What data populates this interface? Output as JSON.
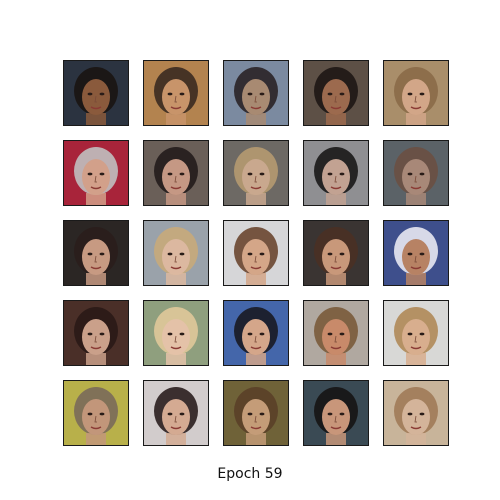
{
  "figure": {
    "caption": "Epoch 59",
    "grid_rows": 5,
    "grid_cols": 5,
    "samples": [
      {
        "bg": "#2b3340",
        "skin": "#8a5a3c",
        "hair": "#1a1412"
      },
      {
        "bg": "#b3834f",
        "skin": "#c8946a",
        "hair": "#3a2a20"
      },
      {
        "bg": "#7b8aa0",
        "skin": "#a88a72",
        "hair": "#2a2226"
      },
      {
        "bg": "#5d5046",
        "skin": "#9c6a4e",
        "hair": "#1e1614"
      },
      {
        "bg": "#a98e6a",
        "skin": "#d2a688",
        "hair": "#8a6a48"
      },
      {
        "bg": "#a8243a",
        "skin": "#d2a08a",
        "hair": "#c0c0c0"
      },
      {
        "bg": "#6a5f58",
        "skin": "#c59884",
        "hair": "#241c1c"
      },
      {
        "bg": "#6d6964",
        "skin": "#c9a88e",
        "hair": "#b59a70"
      },
      {
        "bg": "#8f8f92",
        "skin": "#c2a292",
        "hair": "#1a1818"
      },
      {
        "bg": "#5b6267",
        "skin": "#a88878",
        "hair": "#6a5042"
      },
      {
        "bg": "#2b2624",
        "skin": "#c79a82",
        "hair": "#2a1e1c"
      },
      {
        "bg": "#9aa2aa",
        "skin": "#dcb8a0",
        "hair": "#c8aa7a"
      },
      {
        "bg": "#d6d6d8",
        "skin": "#d4a688",
        "hair": "#6a4630"
      },
      {
        "bg": "#3a3432",
        "skin": "#c8987a",
        "hair": "#4a3024"
      },
      {
        "bg": "#3e4f8c",
        "skin": "#b78264",
        "hair": "#e8e8f2"
      },
      {
        "bg": "#4a2f28",
        "skin": "#caa08a",
        "hair": "#2a1a16"
      },
      {
        "bg": "#8f9f7e",
        "skin": "#e4c2a8",
        "hair": "#e0c89a"
      },
      {
        "bg": "#4466aa",
        "skin": "#d4a68a",
        "hair": "#1a1a22"
      },
      {
        "bg": "#b0a8a0",
        "skin": "#c88a6a",
        "hair": "#7a5a3a"
      },
      {
        "bg": "#d8d8d6",
        "skin": "#d8ae8e",
        "hair": "#b08a58"
      },
      {
        "bg": "#b8b04a",
        "skin": "#c2967a",
        "hair": "#7a6a5a"
      },
      {
        "bg": "#d2cccc",
        "skin": "#d4aa92",
        "hair": "#2a1e1e"
      },
      {
        "bg": "#6f6238",
        "skin": "#c49c78",
        "hair": "#5a4028"
      },
      {
        "bg": "#3a4a54",
        "skin": "#c8967a",
        "hair": "#161414"
      },
      {
        "bg": "#c8b49a",
        "skin": "#d4b49a",
        "hair": "#a07a58"
      }
    ]
  }
}
